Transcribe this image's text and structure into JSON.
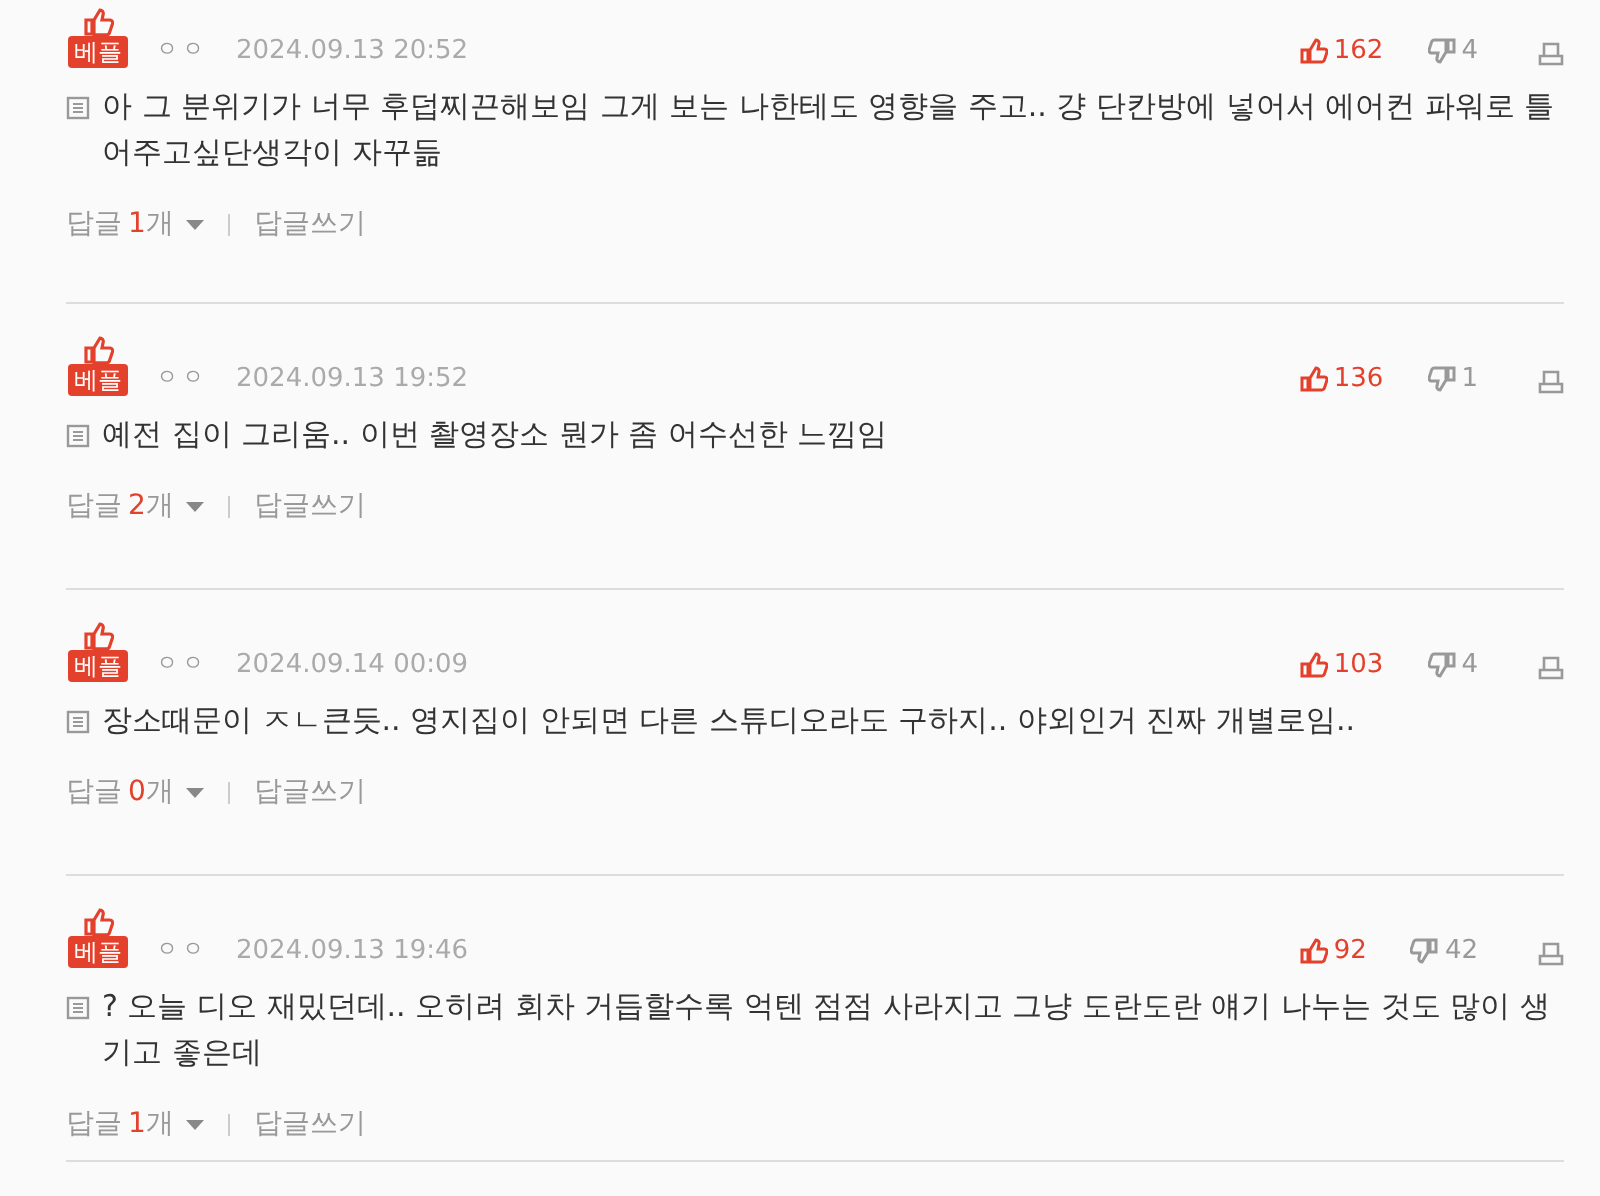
{
  "comments": [
    {
      "badge": "베플",
      "author": "ㅇㅇ",
      "date": "2024.09.13 20:52",
      "likes": "162",
      "dislikes": "4",
      "text": "아 그 분위기가 너무 후덥찌끈해보임 그게 보는 나한테도 영향을 주고.. 걍 단칸방에 넣어서 에어컨 파워로 틀어주고싶단생각이 자꾸듦",
      "reply_label": "답글",
      "reply_count": "1",
      "reply_unit": "개",
      "write_reply": "답글쓰기"
    },
    {
      "badge": "베플",
      "author": "ㅇㅇ",
      "date": "2024.09.13 19:52",
      "likes": "136",
      "dislikes": "1",
      "text": "예전 집이 그리움.. 이번 촬영장소 뭔가 좀 어수선한 느낌임",
      "reply_label": "답글",
      "reply_count": "2",
      "reply_unit": "개",
      "write_reply": "답글쓰기"
    },
    {
      "badge": "베플",
      "author": "ㅇㅇ",
      "date": "2024.09.14 00:09",
      "likes": "103",
      "dislikes": "4",
      "text": "장소때문이 ㅈㄴ큰듯.. 영지집이 안되면 다른 스튜디오라도 구하지.. 야외인거 진짜 개별로임..",
      "reply_label": "답글",
      "reply_count": "0",
      "reply_unit": "개",
      "write_reply": "답글쓰기"
    },
    {
      "badge": "베플",
      "author": "ㅇㅇ",
      "date": "2024.09.13 19:46",
      "likes": "92",
      "dislikes": "42",
      "text": "? 오늘 디오 재밌던데.. 오히려 회차 거듭할수록 억텐 점점 사라지고 그냥 도란도란 얘기 나누는 것도 많이 생기고 좋은데",
      "reply_label": "답글",
      "reply_count": "1",
      "reply_unit": "개",
      "write_reply": "답글쓰기"
    }
  ]
}
